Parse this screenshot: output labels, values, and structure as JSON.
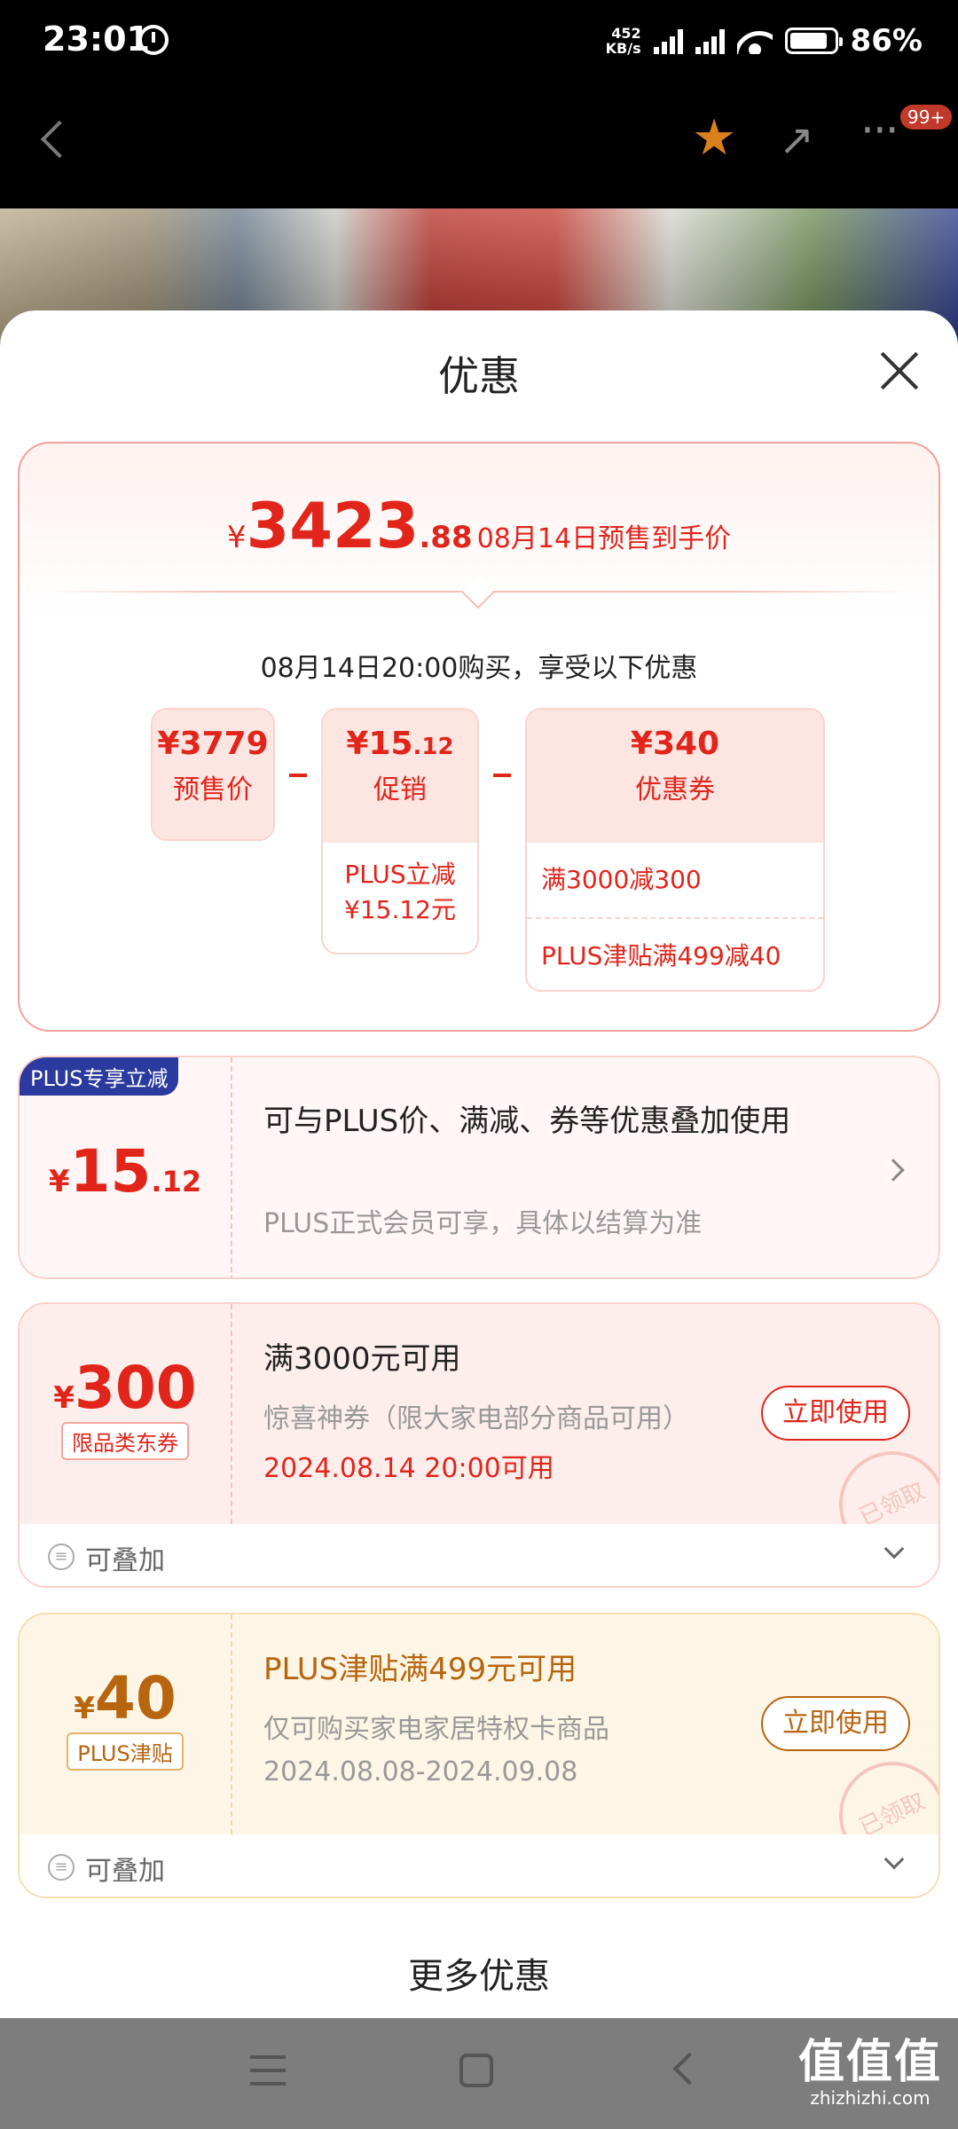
{
  "status_bar": {
    "time": "23:01",
    "speed_value": "452",
    "speed_unit": "KB/s",
    "battery": "86%"
  },
  "nav": {
    "badge": "99+"
  },
  "sheet": {
    "title": "优惠",
    "summary": {
      "currency": "¥",
      "price_int": "3423",
      "price_dec": ".88",
      "price_label": "08月14日预售到手价",
      "buy_line": "08月14日20:00购买，享受以下优惠",
      "presale": {
        "value": "¥3779",
        "label": "预售价"
      },
      "promo": {
        "value": "¥15",
        "value_dec": ".12",
        "label": "促销",
        "detail_1": "PLUS立减",
        "detail_2": "¥15.12元"
      },
      "coupon": {
        "value": "¥340",
        "label": "优惠券",
        "rows": [
          "满3000减300",
          "PLUS津贴满499减40"
        ]
      }
    },
    "cards": [
      {
        "tag": "PLUS专享立减",
        "currency": "¥",
        "amount_int": "15",
        "amount_dec": ".12",
        "title": "可与PLUS价、满减、券等优惠叠加使用",
        "sub": "PLUS正式会员可享，具体以结算为准"
      },
      {
        "currency": "¥",
        "amount_int": "300",
        "chip": "限品类东券",
        "title": "满3000元可用",
        "sub": "惊喜神券（限大家电部分商品可用）",
        "date": "2024.08.14 20:00可用",
        "button": "立即使用",
        "stamp": "已领取",
        "foot": "可叠加"
      },
      {
        "currency": "¥",
        "amount_int": "40",
        "chip": "PLUS津贴",
        "title": "PLUS津贴满499元可用",
        "sub": "仅可购买家电家居特权卡商品",
        "date": "2024.08.08-2024.09.08",
        "button": "立即使用",
        "stamp": "已领取",
        "foot": "可叠加"
      }
    ],
    "more": "更多优惠"
  },
  "watermark": {
    "brand": "值值值",
    "site": "zhizhizhi.com"
  },
  "colors": {
    "accent": "#e1251b",
    "gold": "#b8650f",
    "plus_blue": "#2a3a9e"
  }
}
